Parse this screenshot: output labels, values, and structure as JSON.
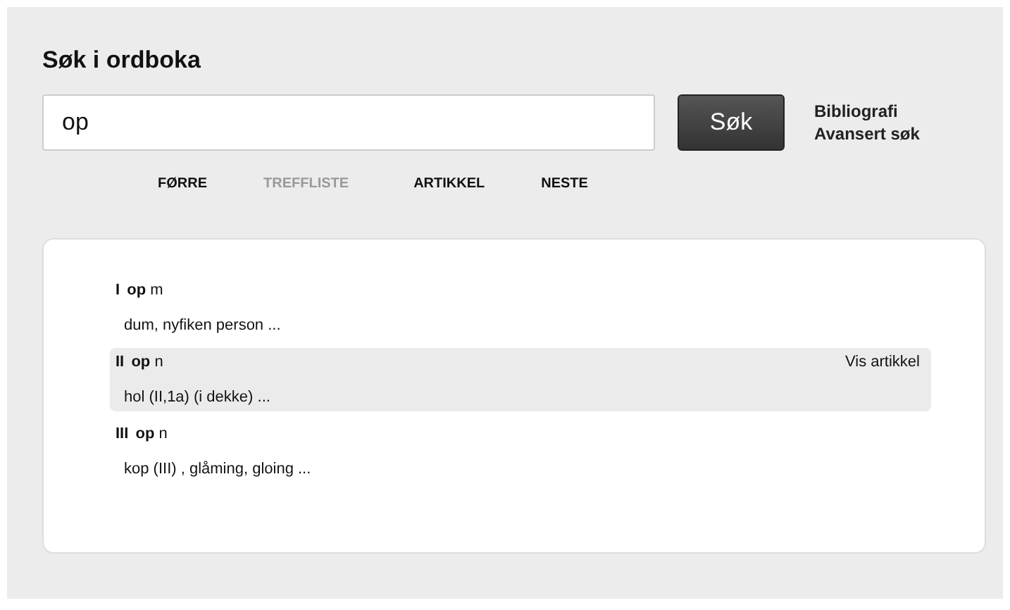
{
  "search": {
    "title": "Søk i ordboka",
    "value": "op",
    "button": "Søk",
    "links": [
      "Bibliografi",
      "Avansert søk"
    ]
  },
  "nav": [
    {
      "label": "FØRRE",
      "disabled": false
    },
    {
      "label": "TREFFLISTE",
      "disabled": true
    },
    {
      "label": "ARTIKKEL",
      "disabled": false
    },
    {
      "label": "NESTE",
      "disabled": false
    }
  ],
  "results": [
    {
      "numeral": "I",
      "headword": "op",
      "gender": "m",
      "definition": "dum, nyfiken person ...",
      "selected": false
    },
    {
      "numeral": "II",
      "headword": "op",
      "gender": "n",
      "definition": "hol (II,1a) (i dekke) ...",
      "selected": true,
      "action": "Vis artikkel"
    },
    {
      "numeral": "III",
      "headword": "op",
      "gender": "n",
      "definition": "kop (III) , glåming, gloing ...",
      "selected": false
    }
  ]
}
